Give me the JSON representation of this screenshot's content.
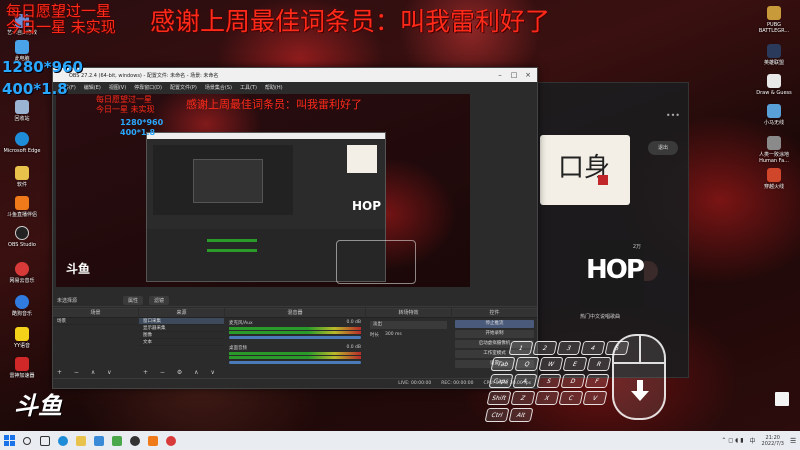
{
  "overlay": {
    "top_line1": "每日愿望过一星",
    "top_line2": "今日一星 未实现",
    "banner": "感谢上周最佳词条员：叫我雷利好了",
    "res1": "1280*960",
    "res2": "400*1.8",
    "brand": "斗鱼"
  },
  "desktop_left": [
    {
      "label": "艺术自由修改"
    },
    {
      "label": "此电脑"
    },
    {
      "label": "回收站"
    },
    {
      "label": "Microsoft Edge"
    },
    {
      "label": "软件"
    },
    {
      "label": "斗鱼直播伴侣"
    },
    {
      "label": "OBS Studio"
    },
    {
      "label": "网易云音乐"
    },
    {
      "label": "酷狗音乐"
    },
    {
      "label": "YY语音"
    },
    {
      "label": "雷神加速器"
    }
  ],
  "desktop_right": [
    {
      "label": "PUBG BATTLEGR..."
    },
    {
      "label": "英雄联盟"
    },
    {
      "label": "Draw & Guess"
    },
    {
      "label": "小马无线"
    },
    {
      "label": "人类一败涂地 Human Fa..."
    },
    {
      "label": "穿越火线"
    }
  ],
  "obs": {
    "title": "OBS 27.2.4 (64-bit, windows) - 配置文件: 未命名 - 场景: 未命名",
    "menu": [
      "文件(F)",
      "编辑(E)",
      "视图(V)",
      "停靠窗口(D)",
      "配置文件(P)",
      "场景集合(S)",
      "工具(T)",
      "帮助(H)"
    ],
    "toolbar_label": "未选择源",
    "props_button": "属性",
    "filters_button": "滤镜",
    "docks": {
      "scenes": "场景",
      "sources": "来源",
      "mixer": "混音器",
      "transitions": "转场特效",
      "controls": "控件"
    },
    "scene_items": [
      "场景"
    ],
    "source_items": [
      "窗口采集",
      "显示器采集",
      "图像",
      "文本"
    ],
    "mixer_tracks": [
      {
        "name": "麦克风/Aux",
        "db": "0.0 dB"
      },
      {
        "name": "桌面音频",
        "db": "0.0 dB"
      }
    ],
    "transition": {
      "type": "淡出",
      "duration_label": "时长",
      "duration": "300 ms"
    },
    "controls": [
      "停止推流",
      "开始录制",
      "启动虚拟摄像机",
      "工作室模式",
      "设置",
      "退出"
    ],
    "status": {
      "live": "LIVE: 00:00:00",
      "rec": "REC: 00:00:00",
      "cpu": "CPU: 5.3%, 30.00 fps"
    }
  },
  "music": {
    "logo_text": "口身",
    "hop_text": "HOP",
    "caption": "热门中文说唱歌曲",
    "button": "退出",
    "count": "2万"
  },
  "keyboard": {
    "row1": [
      "1",
      "2",
      "3",
      "4",
      "5"
    ],
    "row2": [
      "Tab",
      "Q",
      "W",
      "E",
      "R"
    ],
    "row3": [
      "Caps",
      "A",
      "S",
      "D",
      "F"
    ],
    "row4": [
      "Shift",
      "Z",
      "X",
      "C",
      "V"
    ],
    "row5": [
      "Ctrl",
      "Alt"
    ]
  },
  "taskbar": {
    "time": "21:20",
    "date": "2022/7/3",
    "lang": "中"
  },
  "colors": {
    "accent_red": "#ff2a1a",
    "accent_blue": "#29a8ff",
    "obs_bg": "#2b2b2b"
  }
}
